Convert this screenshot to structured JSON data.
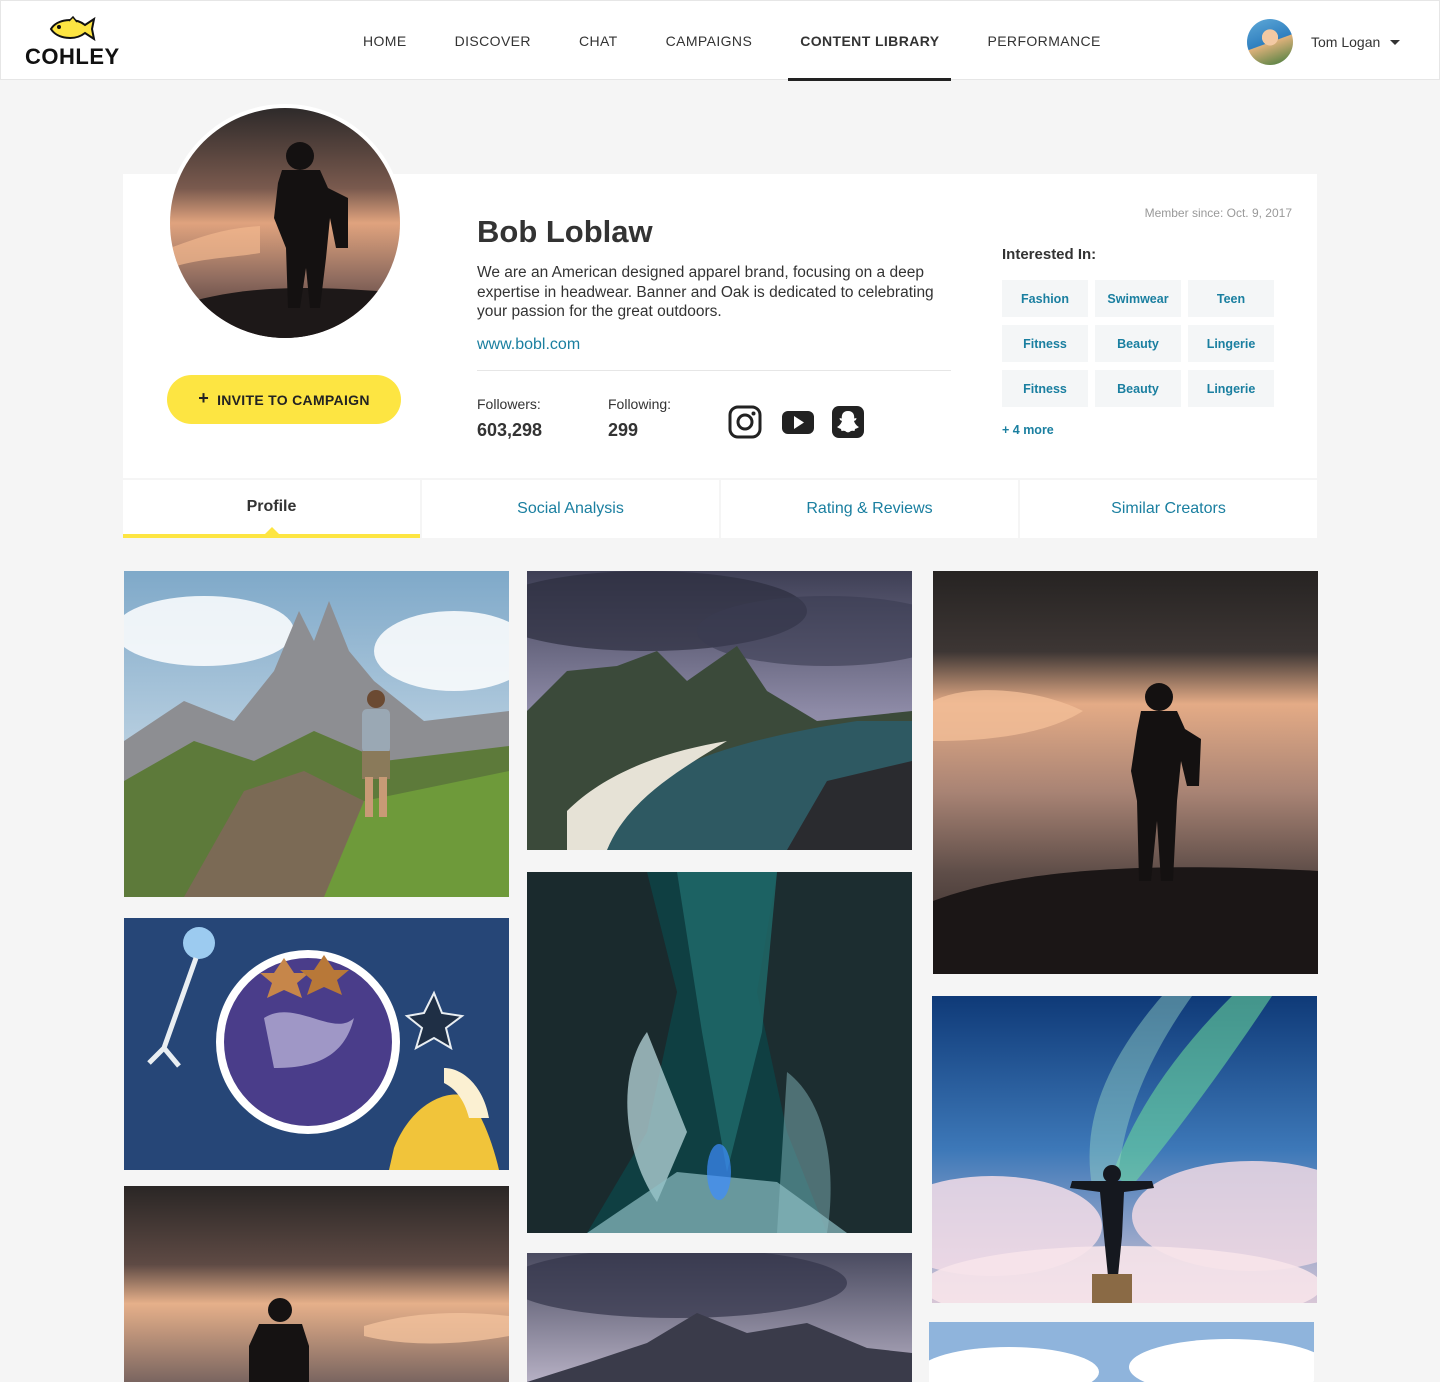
{
  "brand": {
    "name": "COHLEY",
    "accent": "#fde542",
    "link_color": "#1a7fa0"
  },
  "nav": {
    "items": [
      {
        "label": "HOME",
        "active": false
      },
      {
        "label": "DISCOVER",
        "active": false
      },
      {
        "label": "CHAT",
        "active": false
      },
      {
        "label": "CAMPAIGNS",
        "active": false
      },
      {
        "label": "CONTENT LIBRARY",
        "active": true
      },
      {
        "label": "PERFORMANCE",
        "active": false
      }
    ]
  },
  "user": {
    "name": "Tom Logan"
  },
  "profile": {
    "name": "Bob Loblaw",
    "description": "We are an American designed apparel brand, focusing on a deep expertise in headwear. Banner and Oak is dedicated to celebrating your passion for the great outdoors.",
    "website": "www.bobl.com",
    "followers_label": "Followers:",
    "followers": "603,298",
    "following_label": "Following:",
    "following": "299",
    "member_since": "Member since: Oct. 9, 2017",
    "invite_label": "INVITE TO CAMPAIGN",
    "social_icons": [
      "instagram-icon",
      "youtube-icon",
      "snapchat-icon"
    ]
  },
  "interests": {
    "title": "Interested In:",
    "chips": [
      "Fashion",
      "Swimwear",
      "Teen",
      "Fitness",
      "Beauty",
      "Lingerie",
      "Fitness",
      "Beauty",
      "Lingerie"
    ],
    "more": "+ 4 more"
  },
  "tabs": [
    {
      "label": "Profile",
      "active": true
    },
    {
      "label": "Social Analysis",
      "active": false
    },
    {
      "label": "Rating & Reviews",
      "active": false
    },
    {
      "label": "Similar Creators",
      "active": false
    }
  ]
}
